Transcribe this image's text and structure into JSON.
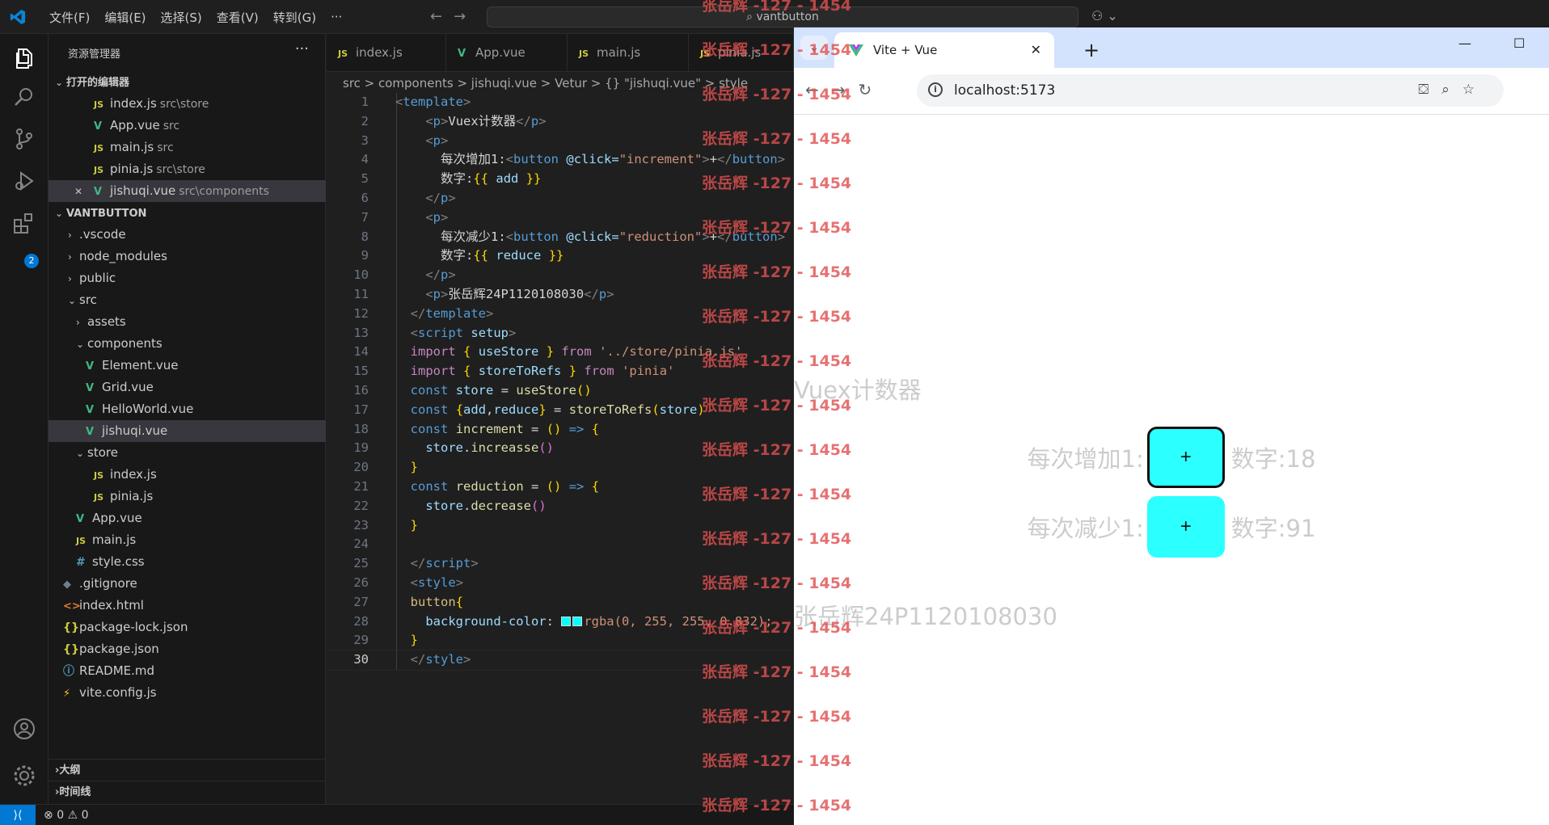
{
  "titlebar": {
    "menu": [
      "文件(F)",
      "编辑(E)",
      "选择(S)",
      "查看(V)",
      "转到(G)",
      "···"
    ],
    "search_text": "vantbutton"
  },
  "sidebar": {
    "title": "资源管理器",
    "more": "···",
    "open_editors_label": "打开的编辑器",
    "open_editors": [
      {
        "name": "index.js",
        "hint": "src\\store",
        "icon": "JS"
      },
      {
        "name": "App.vue",
        "hint": "src",
        "icon": "V"
      },
      {
        "name": "main.js",
        "hint": "src",
        "icon": "JS"
      },
      {
        "name": "pinia.js",
        "hint": "src\\store",
        "icon": "JS"
      },
      {
        "name": "jishuqi.vue",
        "hint": "src\\components",
        "icon": "V"
      }
    ],
    "project_label": "VANTBUTTON",
    "tree": [
      {
        "name": ".vscode",
        "icon": ""
      },
      {
        "name": "node_modules",
        "icon": ""
      },
      {
        "name": "public",
        "icon": ""
      },
      {
        "name": "src",
        "icon": ""
      },
      {
        "name": "assets",
        "icon": ""
      },
      {
        "name": "components",
        "icon": ""
      },
      {
        "name": "Element.vue",
        "icon": "V"
      },
      {
        "name": "Grid.vue",
        "icon": "V"
      },
      {
        "name": "HelloWorld.vue",
        "icon": "V"
      },
      {
        "name": "jishuqi.vue",
        "icon": "V"
      },
      {
        "name": "store",
        "icon": ""
      },
      {
        "name": "index.js",
        "icon": "JS"
      },
      {
        "name": "pinia.js",
        "icon": "JS"
      },
      {
        "name": "App.vue",
        "icon": "V"
      },
      {
        "name": "main.js",
        "icon": "JS"
      },
      {
        "name": "style.css",
        "icon": "#"
      },
      {
        "name": ".gitignore",
        "icon": "◆"
      },
      {
        "name": "index.html",
        "icon": "<>"
      },
      {
        "name": "package-lock.json",
        "icon": "{}"
      },
      {
        "name": "package.json",
        "icon": "{}"
      },
      {
        "name": "README.md",
        "icon": "ⓘ"
      },
      {
        "name": "vite.config.js",
        "icon": "⚡"
      }
    ],
    "outline_label": "大纲",
    "timeline_label": "时间线",
    "extensions_badge": "2"
  },
  "editor": {
    "tabs": [
      {
        "name": "index.js",
        "icon": "JS"
      },
      {
        "name": "App.vue",
        "icon": "V"
      },
      {
        "name": "main.js",
        "icon": "JS"
      },
      {
        "name": "pinia.js",
        "icon": "JS"
      }
    ],
    "breadcrumb": "src > components > jishuqi.vue > Vetur > {} \"jishuqi.vue\" > style",
    "line_numbers": [
      "1",
      "2",
      "3",
      "4",
      "5",
      "6",
      "7",
      "8",
      "9",
      "10",
      "11",
      "12",
      "13",
      "14",
      "15",
      "16",
      "17",
      "18",
      "19",
      "20",
      "21",
      "22",
      "23",
      "24",
      "25",
      "26",
      "27",
      "28",
      "29",
      "30"
    ],
    "code": {
      "l1": "template",
      "l2": "Vuex计数器",
      "l4a": "每次增加1:",
      "l4b": "@click=",
      "l4c": "\"increment\"",
      "l4d": "+",
      "l5a": "数字:",
      "l5b": "add",
      "l8a": "每次减少1:",
      "l8c": "\"reduction\"",
      "l9b": "reduce",
      "l11": "张岳辉24P1120108030",
      "l13": "setup",
      "l14a": "useStore",
      "l14b": "'../store/pinia.js'",
      "l15a": "storeToRefs",
      "l15b": "'pinia'",
      "l16a": "store",
      "l16b": "useStore",
      "l17a": "add",
      "l17b": "reduce",
      "l17c": "storeToRefs",
      "l18": "increment",
      "l19": "increasse",
      "l21": "reduction",
      "l22": "decrease",
      "l27": "button",
      "l28a": "background-color",
      "l28b": "rgba(0, 255, 255, 0.832);"
    }
  },
  "watermark": "张岳辉 -127 - 1454",
  "browser": {
    "tab_title": "Vite + Vue",
    "url": "localhost:5173",
    "app": {
      "title": "Vuex计数器",
      "inc_label": "每次增加1:",
      "inc_button": "+",
      "inc_value": "数字:18",
      "dec_label": "每次减少1:",
      "dec_button": "+",
      "dec_value": "数字:91",
      "name": "张岳辉24P1120108030"
    }
  },
  "status": {
    "errors": "0",
    "warnings": "0"
  }
}
